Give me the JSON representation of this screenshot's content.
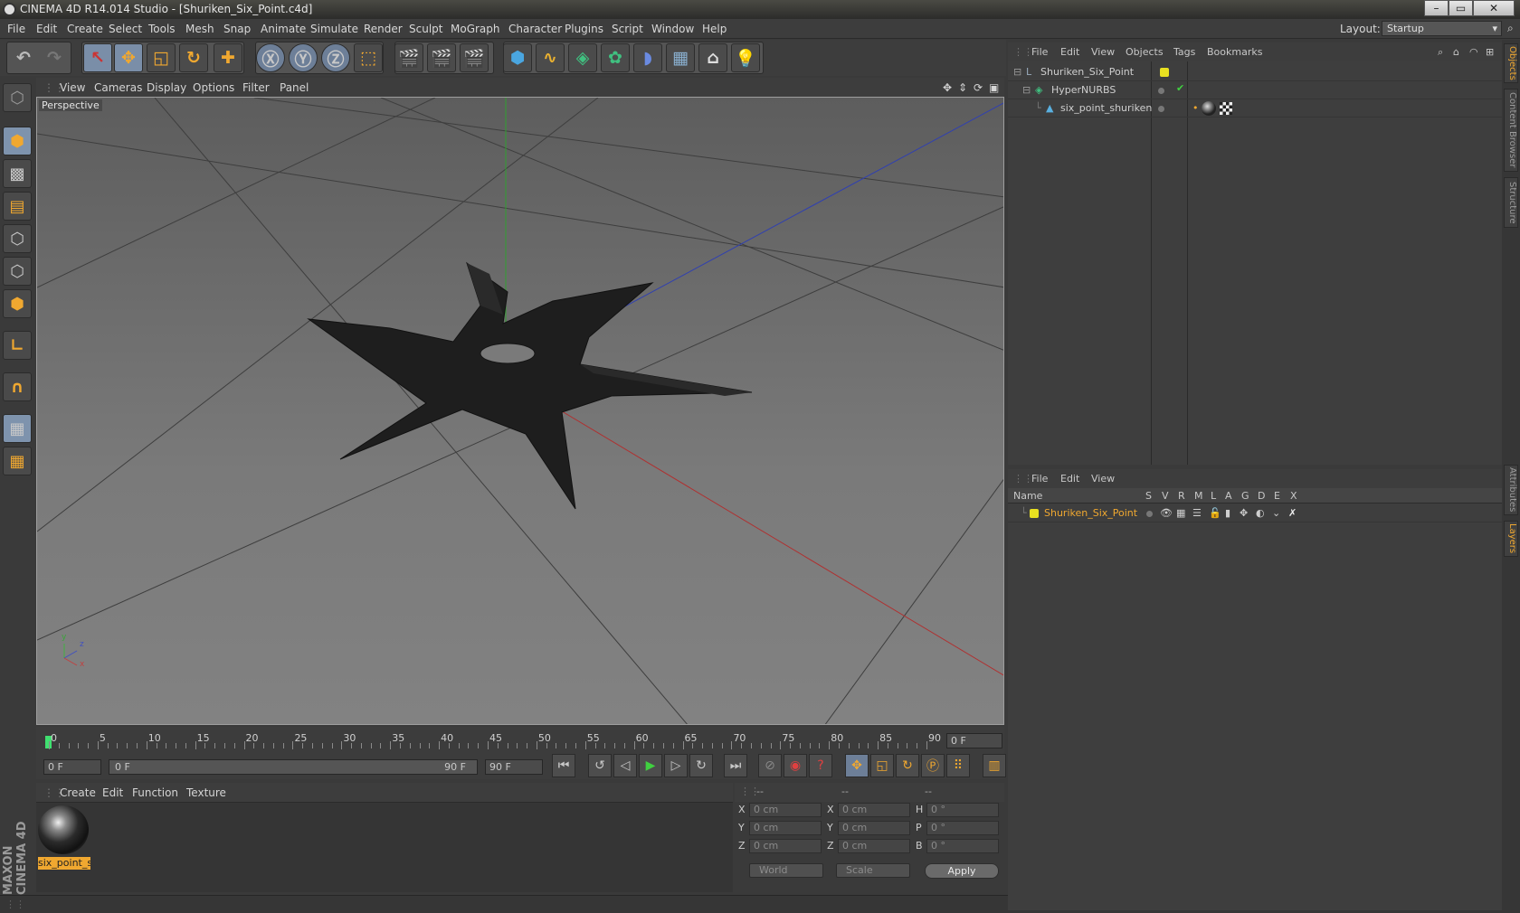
{
  "window": {
    "title": "CINEMA 4D R14.014 Studio - [Shuriken_Six_Point.c4d]",
    "min": "–",
    "max": "▭",
    "close": "✕"
  },
  "menubar": {
    "items": [
      "File",
      "Edit",
      "Create",
      "Select",
      "Tools",
      "Mesh",
      "Snap",
      "Animate",
      "Simulate",
      "Render",
      "Sculpt",
      "MoGraph",
      "Character",
      "Plugins",
      "Script",
      "Window",
      "Help"
    ],
    "layout_label": "Layout:",
    "layout_value": "Startup"
  },
  "viewport": {
    "menu": [
      "View",
      "Cameras",
      "Display",
      "Options",
      "Filter",
      "Panel"
    ],
    "label": "Perspective",
    "axes": {
      "y": "y",
      "z": "z",
      "x": "x"
    }
  },
  "timeline": {
    "ticks": [
      0,
      5,
      10,
      15,
      20,
      25,
      30,
      35,
      40,
      45,
      50,
      55,
      60,
      65,
      70,
      75,
      80,
      85,
      90
    ],
    "current_frame": "0 F"
  },
  "transport": {
    "start_field": "0 F",
    "range_start": "0 F",
    "range_end": "90 F",
    "end_field": "90 F"
  },
  "material_manager": {
    "menu": [
      "Create",
      "Edit",
      "Function",
      "Texture"
    ],
    "material_name": "six_point_s"
  },
  "coordinates": {
    "head": [
      "--",
      "--",
      "--"
    ],
    "rows": [
      {
        "l1": "X",
        "v1": "0 cm",
        "l2": "X",
        "v2": "0 cm",
        "l3": "H",
        "v3": "0 °"
      },
      {
        "l1": "Y",
        "v1": "0 cm",
        "l2": "Y",
        "v2": "0 cm",
        "l3": "P",
        "v3": "0 °"
      },
      {
        "l1": "Z",
        "v1": "0 cm",
        "l2": "Z",
        "v2": "0 cm",
        "l3": "B",
        "v3": "0 °"
      }
    ],
    "mode": "World",
    "type": "Scale",
    "apply": "Apply"
  },
  "object_manager": {
    "menu": [
      "File",
      "Edit",
      "View",
      "Objects",
      "Tags",
      "Bookmarks"
    ],
    "objects": [
      {
        "name": "Shuriken_Six_Point"
      },
      {
        "name": "HyperNURBS"
      },
      {
        "name": "six_point_shuriken"
      }
    ]
  },
  "layer_manager": {
    "menu": [
      "File",
      "Edit",
      "View"
    ],
    "columns": [
      "Name",
      "S",
      "V",
      "R",
      "M",
      "L",
      "A",
      "G",
      "D",
      "E",
      "X"
    ],
    "layers": [
      {
        "name": "Shuriken_Six_Point"
      }
    ]
  },
  "side_tabs": [
    "Objects",
    "Content Browser",
    "Structure",
    "Attributes",
    "Layers"
  ],
  "brand": "MAXON CINEMA 4D",
  "colors": {
    "accent": "#f0a830",
    "selected": "#7e93ad",
    "x_axis": "#c03030",
    "y_axis": "#30a030",
    "z_axis": "#3040c0"
  }
}
